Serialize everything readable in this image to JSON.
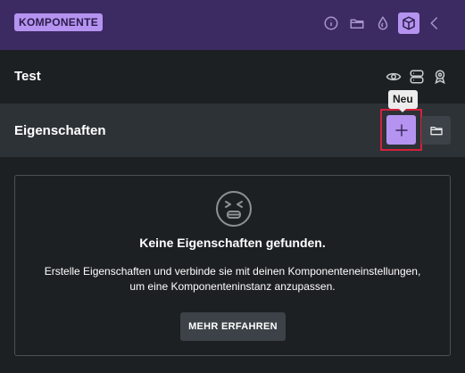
{
  "header": {
    "badge_label": "KOMPONENTE",
    "icons": [
      "info-icon",
      "folder-icon",
      "droplet-icon",
      "cube-icon",
      "chevron-left-icon"
    ],
    "active_icon": "cube-icon",
    "accent_color": "#b593f0",
    "background_color": "#3c2b63"
  },
  "component": {
    "title": "Test",
    "icons": [
      "eye-icon",
      "server-icon",
      "award-icon"
    ]
  },
  "properties": {
    "title": "Eigenschaften",
    "add_tooltip": "Neu",
    "add_icon": "plus-icon",
    "folder_icon": "folder-icon"
  },
  "empty_state": {
    "icon": "tired-face-icon",
    "title": "Keine Eigenschaften gefunden.",
    "text_line1": "Erstelle Eigenschaften und verbinde sie mit deinen Komponenteneinstellungen,",
    "text_line2": "um eine Komponenteninstanz anzupassen.",
    "button_label": "MEHR ERFAHREN"
  }
}
